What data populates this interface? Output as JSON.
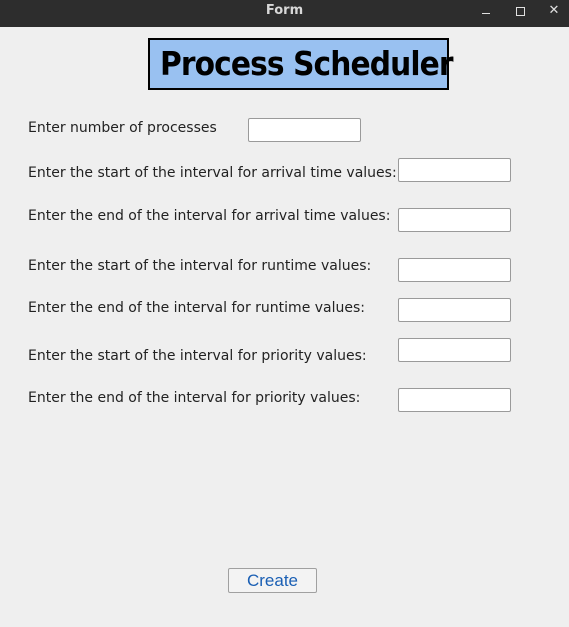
{
  "window": {
    "title": "Form",
    "minimize_icon": "minimize-icon",
    "maximize_icon": "maximize-icon",
    "close_icon": "close-icon",
    "close_glyph": "✕"
  },
  "heading": {
    "text": "Process Scheduler",
    "background": "#99c1f1"
  },
  "form": {
    "fields": [
      {
        "label": "Enter number of processes",
        "value": ""
      },
      {
        "label": "Enter the start of the interval for arrival time values:",
        "value": ""
      },
      {
        "label": "Enter the end of the interval for arrival time values:",
        "value": ""
      },
      {
        "label": "Enter the start of the interval for runtime values:",
        "value": ""
      },
      {
        "label": "Enter the end of the interval for runtime values:",
        "value": ""
      },
      {
        "label": "Enter the start of the interval for priority values:",
        "value": ""
      },
      {
        "label": "Enter the end of the interval for priority values:",
        "value": ""
      }
    ]
  },
  "actions": {
    "create_label": "Create",
    "create_color": "#1a5fb4"
  }
}
